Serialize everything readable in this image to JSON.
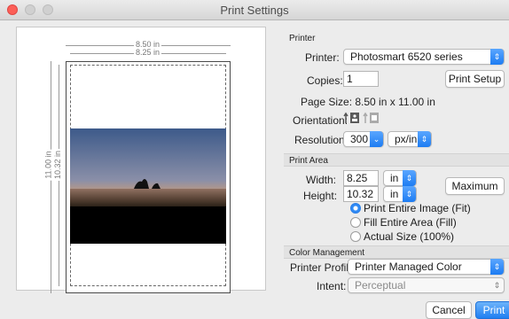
{
  "window": {
    "title": "Print Settings"
  },
  "preview": {
    "paper_width_label": "8.50 in",
    "print_width_label": "8.25 in",
    "paper_height_label": "11.00 in",
    "print_height_label": "10.32 in"
  },
  "printer": {
    "section_label": "Printer",
    "printer_label": "Printer:",
    "printer_value": "Photosmart 6520 series",
    "copies_label": "Copies:",
    "copies_value": "1",
    "setup_button": "Print Setup",
    "page_size_text": "Page Size: 8.50 in x 11.00 in",
    "orientation_label": "Orientation:",
    "resolution_label": "Resolution:",
    "resolution_value": "300",
    "resolution_unit": "px/in"
  },
  "print_area": {
    "section_label": "Print Area",
    "width_label": "Width:",
    "width_value": "8.25",
    "width_unit": "in",
    "height_label": "Height:",
    "height_value": "10.32",
    "height_unit": "in",
    "maximum_button": "Maximum",
    "options": [
      {
        "label": "Print Entire Image (Fit)",
        "selected": true
      },
      {
        "label": "Fill Entire Area (Fill)",
        "selected": false
      },
      {
        "label": "Actual Size (100%)",
        "selected": false
      }
    ]
  },
  "color_management": {
    "section_label": "Color Management",
    "profile_label": "Printer Profile:",
    "profile_value": "Printer Managed Color",
    "intent_label": "Intent:",
    "intent_value": "Perceptual"
  },
  "footer": {
    "cancel_button": "Cancel",
    "print_button": "Print"
  },
  "colors": {
    "accent": "#2f8af5",
    "close": "#fc5f57"
  }
}
